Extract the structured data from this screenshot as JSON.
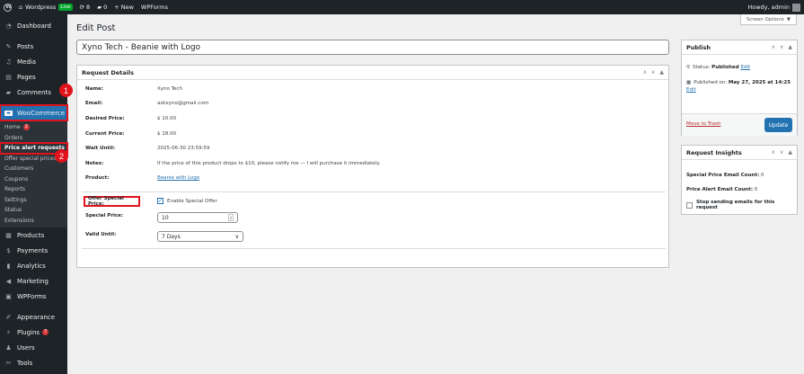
{
  "adminbar": {
    "site_name": "Wordpress",
    "live_badge": "Live",
    "updates_count": "8",
    "comments_count": "0",
    "new_label": "New",
    "wpforms_label": "WPForms",
    "howdy": "Howdy, admin"
  },
  "sidebar": {
    "dashboard": "Dashboard",
    "posts": "Posts",
    "media": "Media",
    "pages": "Pages",
    "comments": "Comments",
    "woocommerce": "WooCommerce",
    "sub": {
      "home": "Home",
      "home_badge": "2",
      "orders": "Orders",
      "price_alert": "Price alert requests",
      "offer_special": "Offer special prices",
      "customers": "Customers",
      "coupons": "Coupons",
      "reports": "Reports",
      "settings": "Settings",
      "status": "Status",
      "extensions": "Extensions"
    },
    "products": "Products",
    "payments": "Payments",
    "analytics": "Analytics",
    "marketing": "Marketing",
    "wpforms": "WPForms",
    "appearance": "Appearance",
    "plugins": "Plugins",
    "plugins_badge": "7",
    "users": "Users",
    "tools": "Tools"
  },
  "callouts": {
    "one": "1",
    "two": "2"
  },
  "header": {
    "page_title": "Edit Post",
    "screen_options": "Screen Options",
    "post_title": "Xyno Tech - Beanie with Logo"
  },
  "request_details": {
    "title": "Request Details",
    "rows": [
      {
        "label": "Name:",
        "value": "Xyno Tech"
      },
      {
        "label": "Email:",
        "value": "askxyno@gmail.com"
      },
      {
        "label": "Desired Price:",
        "value": "$ 10.00"
      },
      {
        "label": "Current Price:",
        "value": "$ 18.00"
      },
      {
        "label": "Wait Until:",
        "value": "2025-06-30 23:59:59"
      },
      {
        "label": "Notes:",
        "value": "If the price of this product drops to $10, please notify me — I will purchase it immediately."
      },
      {
        "label": "Product:",
        "value": "Beanie with Logo"
      }
    ],
    "offer_label": "Offer Special Price:",
    "enable_offer": "Enable Special Offer",
    "special_price_label": "Special Price:",
    "special_price_value": "10",
    "valid_until_label": "Valid Until:",
    "valid_until_value": "7 Days"
  },
  "publish": {
    "title": "Publish",
    "status_label": "Status:",
    "status_value": "Published",
    "edit_link": "Edit",
    "published_on_label": "Published on:",
    "published_on_value": "May 27, 2025 at 14:25",
    "edit_link2": "Edit",
    "trash": "Move to Trash",
    "update": "Update"
  },
  "insights": {
    "title": "Request Insights",
    "special_email_label": "Special Price Email Count:",
    "special_email_value": "0",
    "alert_email_label": "Price Alert Email Count:",
    "alert_email_value": "0",
    "stop_label": "Stop sending emails for this request"
  },
  "colors": {
    "admin_dark": "#1d2327",
    "accent": "#2271b1",
    "highlight": "#e0131c",
    "live": "#00a32a"
  }
}
